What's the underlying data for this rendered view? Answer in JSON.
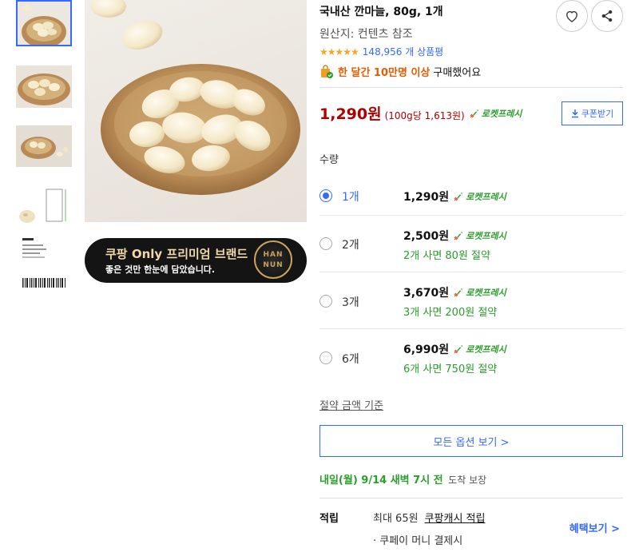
{
  "product": {
    "title": "국내산 깐마늘, 80g, 1개",
    "origin": "원산지: 컨텐츠 참조",
    "rating_stars": "★★★★★",
    "review_count": "148,956 개 상품평",
    "bought_highlight": "한 달간 10만명 이상",
    "bought_text": "구매했어요"
  },
  "banner": {
    "line1": "쿠팡 Only 프리미엄 브랜드",
    "line2": "좋은 것만 한눈에 담았습니다.",
    "seal_top": "HAN",
    "seal_bottom": "NUN"
  },
  "price": {
    "main": "1,290원",
    "unit": "(100g당 1,613원)",
    "rocket_label": "로켓프레시",
    "coupon_label": "쿠폰받기"
  },
  "quantity_label": "수량",
  "options": [
    {
      "qty": "1개",
      "price": "1,290원",
      "rocket": "로켓프레시",
      "save": "",
      "selected": true
    },
    {
      "qty": "2개",
      "price": "2,500원",
      "rocket": "로켓프레시",
      "save": "2개 사면 80원 절약",
      "selected": false
    },
    {
      "qty": "3개",
      "price": "3,670원",
      "rocket": "로켓프레시",
      "save": "3개 사면 200원 절약",
      "selected": false
    },
    {
      "qty": "6개",
      "price": "6,990원",
      "rocket": "로켓프레시",
      "save": "6개 사면 750원 절약",
      "selected": false
    }
  ],
  "savings_basis": "절약 금액 기준",
  "all_options": "모든 옵션 보기 >",
  "delivery": {
    "main": "내일(월) 9/14 새벽 7시 전",
    "guarantee": "도착 보장"
  },
  "points": {
    "label": "적립",
    "max": "최대 65원",
    "link": "쿠팡캐시 적립",
    "sub": "· 쿠페이 머니 결제시",
    "benefit": "혜택보기 >"
  },
  "colors": {
    "accent_blue": "#346aff",
    "price_red": "#ae0000",
    "rocket_green": "#2a9d2a",
    "bought_orange": "#e85b00"
  },
  "icons": [
    "heart-icon",
    "share-icon",
    "download-icon",
    "rocket-icon",
    "bag-check-icon"
  ]
}
